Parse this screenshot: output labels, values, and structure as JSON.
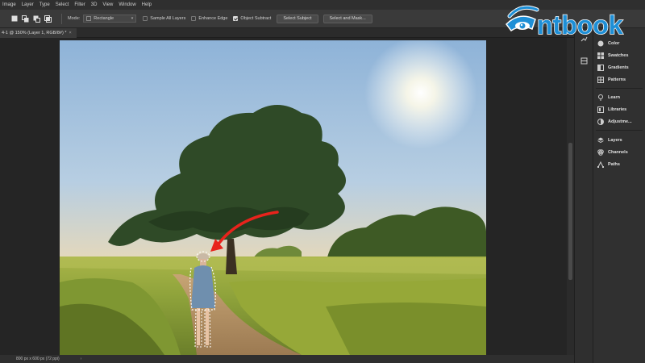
{
  "menu": [
    "Image",
    "Layer",
    "Type",
    "Select",
    "Filter",
    "3D",
    "View",
    "Window",
    "Help"
  ],
  "options": {
    "mode_label": "Mode:",
    "mode_value": "Rectangle",
    "sample_all_layers": "Sample All Layers",
    "enhance_edge": "Enhance Edge",
    "object_subtract": "Object Subtract",
    "select_subject": "Select Subject",
    "select_and_mask": "Select and Mask..."
  },
  "document": {
    "tab_title": "4-1 @ 150% (Layer 1, RGB/8#) *",
    "tab_close": "×"
  },
  "status": {
    "doc_size": "800 px x 600 px (72 ppi)",
    "arrow": "›"
  },
  "panels": [
    {
      "label": "Color",
      "icon": "color-icon"
    },
    {
      "label": "Swatches",
      "icon": "swatches-icon"
    },
    {
      "label": "Gradients",
      "icon": "gradients-icon"
    },
    {
      "label": "Patterns",
      "icon": "patterns-icon"
    },
    {
      "label": "Learn",
      "icon": "learn-icon"
    },
    {
      "label": "Libraries",
      "icon": "libraries-icon"
    },
    {
      "label": "Adjustme...",
      "icon": "adjustments-icon"
    },
    {
      "label": "Layers",
      "icon": "layers-icon"
    },
    {
      "label": "Channels",
      "icon": "channels-icon"
    },
    {
      "label": "Paths",
      "icon": "paths-icon"
    }
  ],
  "logo": {
    "text": "ntbook"
  },
  "colors": {
    "accent": "#1e8fd6",
    "arrow": "#e8231c",
    "panel_bg": "#303030"
  }
}
